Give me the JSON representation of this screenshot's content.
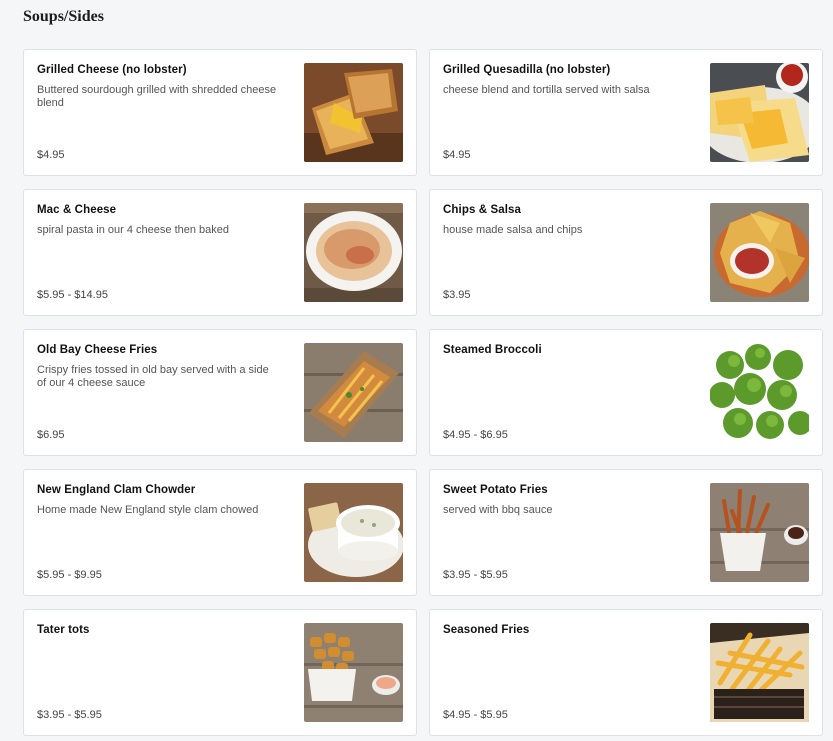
{
  "section": {
    "title": "Soups/Sides"
  },
  "items": [
    {
      "name": "Grilled Cheese (no lobster)",
      "description": "Buttered sourdough grilled with shredded cheese blend",
      "price": "$4.95",
      "image": "grilled-cheese-photo"
    },
    {
      "name": "Grilled Quesadilla (no lobster)",
      "description": "cheese blend and tortilla served with salsa",
      "price": "$4.95",
      "image": "quesadilla-photo"
    },
    {
      "name": "Mac & Cheese",
      "description": "spiral pasta in our 4 cheese then baked",
      "price": "$5.95 - $14.95",
      "image": "mac-cheese-photo"
    },
    {
      "name": "Chips & Salsa",
      "description": "house made salsa and chips",
      "price": "$3.95",
      "image": "chips-salsa-photo"
    },
    {
      "name": "Old Bay Cheese Fries",
      "description": "Crispy fries tossed in old bay served with a side of our 4 cheese sauce",
      "price": "$6.95",
      "image": "cheese-fries-photo"
    },
    {
      "name": "Steamed Broccoli",
      "description": "",
      "price": "$4.95 - $6.95",
      "image": "broccoli-photo"
    },
    {
      "name": "New England Clam Chowder",
      "description": "Home made New England style clam chowed",
      "price": "$5.95 - $9.95",
      "image": "clam-chowder-photo"
    },
    {
      "name": "Sweet Potato Fries",
      "description": "served with bbq sauce",
      "price": "$3.95 - $5.95",
      "image": "sweet-potato-fries-photo"
    },
    {
      "name": "Tater tots",
      "description": "",
      "price": "$3.95 - $5.95",
      "image": "tater-tots-photo"
    },
    {
      "name": "Seasoned Fries",
      "description": "",
      "price": "$4.95 - $5.95",
      "image": "seasoned-fries-photo"
    }
  ],
  "colors": {
    "page_bg": "#f5f6f8",
    "card_border": "#dfe1e4",
    "title": "#111111",
    "desc": "#555555"
  }
}
